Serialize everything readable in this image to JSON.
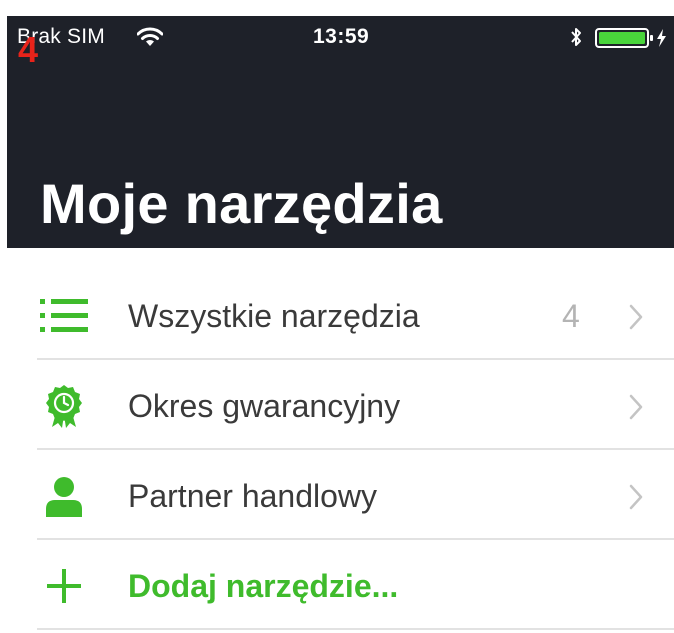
{
  "status_bar": {
    "carrier": "Brak SIM",
    "time": "13:59",
    "icons": [
      "wifi-icon",
      "bluetooth-icon",
      "battery-icon",
      "charging-bolt-icon"
    ]
  },
  "badge": "4",
  "header": {
    "title": "Moje narzędzia"
  },
  "menu": {
    "items": [
      {
        "label": "Wszystkie narzędzia",
        "count": "4",
        "icon": "list-icon"
      },
      {
        "label": "Okres gwarancyjny",
        "count": "",
        "icon": "warranty-badge-icon"
      },
      {
        "label": "Partner handlowy",
        "count": "",
        "icon": "person-icon"
      }
    ],
    "add_label": "Dodaj narzędzie..."
  },
  "colors": {
    "header_background": "#1e2129",
    "accent_green": "#3fbb2c",
    "badge_red": "#e8231a",
    "separator": "#e2e2e2"
  }
}
